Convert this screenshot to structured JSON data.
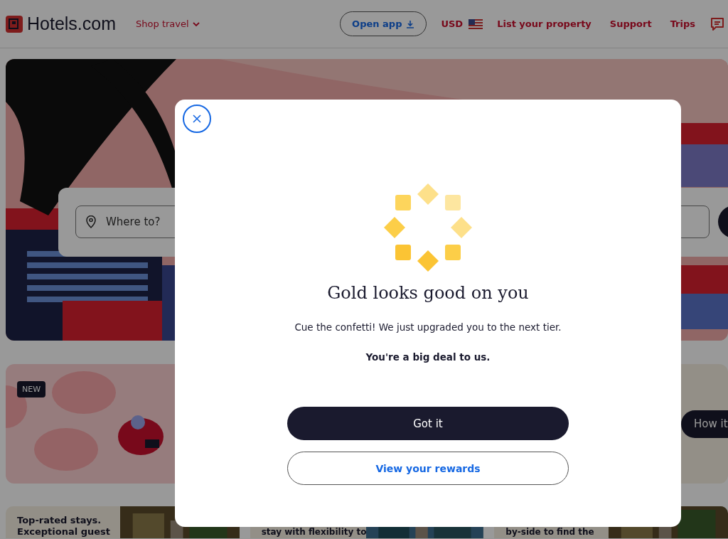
{
  "header": {
    "logo": "Hotels.com",
    "shop_menu": "Shop travel",
    "open_app": "Open app",
    "currency": "USD",
    "links": [
      "List your property",
      "Support",
      "Trips"
    ]
  },
  "hero": {
    "search_placeholder": "Where to?"
  },
  "promo": {
    "badge": "NEW",
    "button": "How it"
  },
  "cards": [
    {
      "text": "Top-rated stays. Exceptional guest"
    },
    {
      "text": "stay with flexibility to"
    },
    {
      "text": "by-side to find the"
    }
  ],
  "modal": {
    "title": "Gold looks good on you",
    "message": "Cue the confetti! We just upgraded you to the next tier.",
    "emphasis": "You're a big deal to us.",
    "primary_button": "Got it",
    "secondary_button": "View your rewards"
  }
}
